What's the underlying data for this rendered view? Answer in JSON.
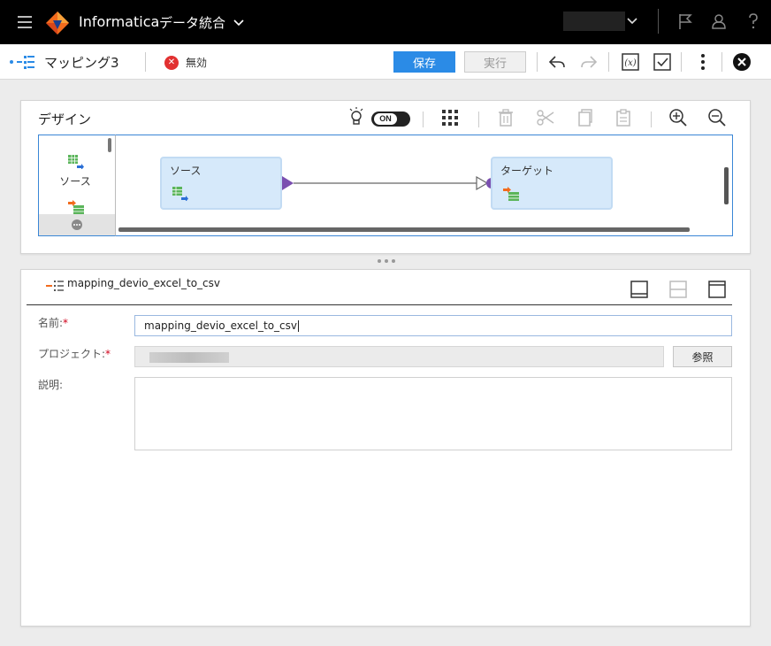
{
  "topbar": {
    "brand": "Informatica",
    "product": "データ統合",
    "menu_icon": "hamburger-icon",
    "icons": [
      "chevron-down-icon",
      "flag-icon",
      "user-icon",
      "help-icon"
    ]
  },
  "toolbar": {
    "mapping_name": "マッピング3",
    "status": "無効",
    "save_label": "保存",
    "run_label": "実行",
    "icons": [
      "undo-icon",
      "redo-icon",
      "expression-icon",
      "validate-icon",
      "more-vertical-icon",
      "close-icon"
    ]
  },
  "design": {
    "title": "デザイン",
    "toggle_label": "ON",
    "palette": {
      "source_label": "ソース"
    },
    "nodes": {
      "source_label": "ソース",
      "target_label": "ターゲット"
    },
    "icons": [
      "lightbulb-icon",
      "grid-icon",
      "trash-icon",
      "scissors-icon",
      "copy-icon",
      "paste-icon",
      "zoom-in-icon",
      "zoom-out-icon"
    ]
  },
  "properties": {
    "header_title": "mapping_devio_excel_to_csv",
    "name_label": "名前:",
    "name_value": "mapping_devio_excel_to_csv",
    "project_label": "プロジェクト:",
    "project_value": "",
    "browse_label": "参照",
    "description_label": "説明:",
    "description_value": "",
    "required_mark": "*"
  },
  "colors": {
    "accent": "#2b8be6",
    "error": "#e23030",
    "port_source": "#7a4fb0",
    "node_fill": "#d6e9fa",
    "brand_orange": "#f26b1d"
  }
}
